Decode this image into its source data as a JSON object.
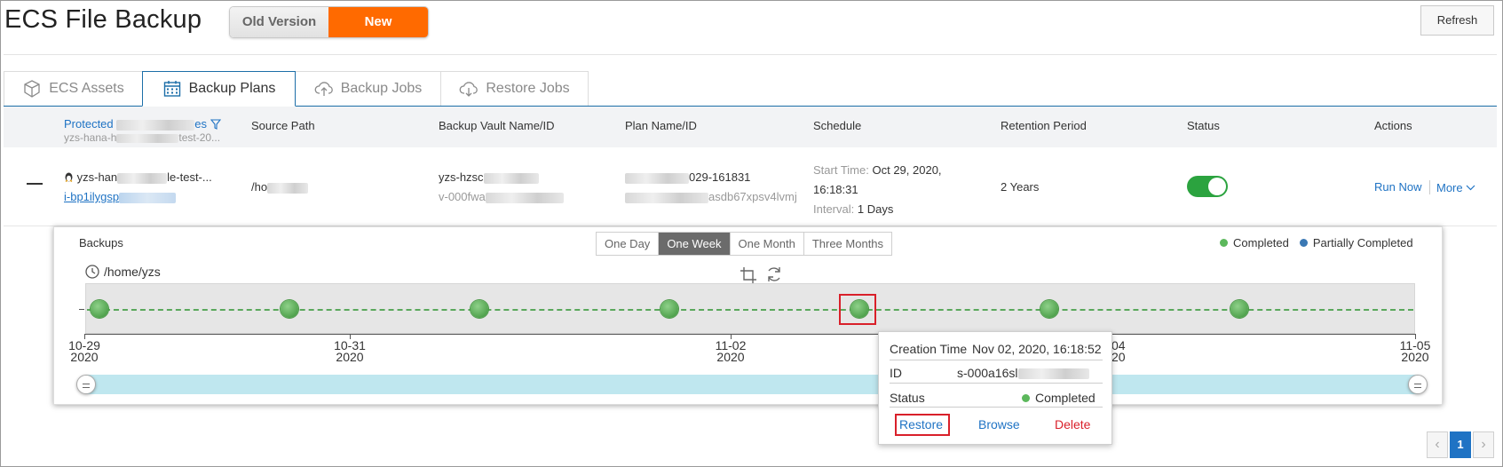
{
  "header": {
    "title": "ECS File Backup",
    "old_version": "Old Version",
    "new_version": "New Version",
    "refresh": "Refresh"
  },
  "tabs": [
    {
      "label": "ECS Assets",
      "icon": "cube-icon"
    },
    {
      "label": "Backup Plans",
      "icon": "calendar-icon"
    },
    {
      "label": "Backup Jobs",
      "icon": "cloud-upload-icon"
    },
    {
      "label": "Restore Jobs",
      "icon": "cloud-download-icon"
    }
  ],
  "table": {
    "columns": {
      "protected_a": "Protected ",
      "protected_b": "es",
      "protected_sub_a": "yzs-hana-h",
      "protected_sub_b": "test-20...",
      "source_path": "Source Path",
      "vault": "Backup Vault Name/ID",
      "plan": "Plan Name/ID",
      "schedule": "Schedule",
      "retention": "Retention Period",
      "status": "Status",
      "actions": "Actions"
    },
    "row": {
      "instance_name_a": "yzs-han",
      "instance_name_b": "le-test-...",
      "instance_id": "i-bp1ilygsp",
      "source_path": "/ho",
      "vault_name": "yzs-hzsc",
      "vault_id": "v-000fwa",
      "plan_name": "029-161831",
      "plan_id": "asdb67xpsv4lvmj",
      "start_time_label": "Start Time:",
      "start_time_value": "Oct 29, 2020,",
      "start_time_value2": "16:18:31",
      "interval_label": "Interval:",
      "interval_value": "1 Days",
      "retention": "2 Years",
      "run_now": "Run Now",
      "more": "More"
    }
  },
  "backups": {
    "title": "Backups",
    "path": "/home/yzs",
    "ranges": [
      "One Day",
      "One Week",
      "One Month",
      "Three Months"
    ],
    "active_range": "One Week",
    "legend": [
      {
        "label": "Completed",
        "color": "#5cb85c"
      },
      {
        "label": "Partially Completed",
        "color": "#3a78b4"
      }
    ],
    "axis_ticks": [
      {
        "date": "10-29",
        "year": "2020"
      },
      {
        "date": "10-31",
        "year": "2020"
      },
      {
        "date": "11-02",
        "year": "2020"
      },
      {
        "date": "04",
        "year": "20"
      },
      {
        "date": "11-05",
        "year": "2020"
      }
    ],
    "node_count": 7
  },
  "tooltip": {
    "creation_label": "Creation Time",
    "creation_value": "Nov 02, 2020, 16:18:52",
    "id_label": "ID",
    "id_value": "s-000a16sl",
    "status_label": "Status",
    "status_value": "Completed",
    "restore": "Restore",
    "browse": "Browse",
    "delete": "Delete"
  },
  "pager": {
    "current": "1"
  },
  "colors": {
    "accent": "#1f73c4",
    "brand": "#ff6a00",
    "danger": "#d9202a",
    "success": "#2ba33f"
  }
}
